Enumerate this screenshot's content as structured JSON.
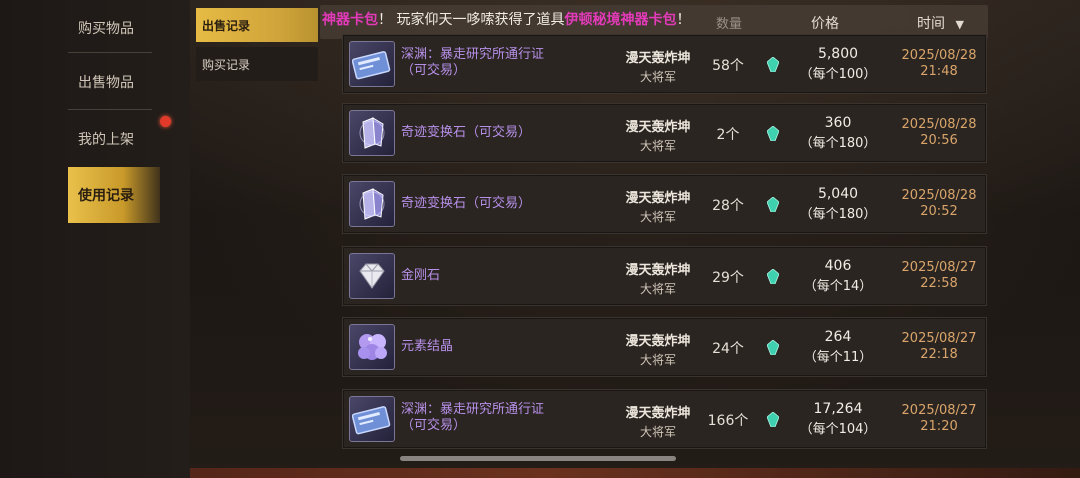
{
  "nav": {
    "items": [
      {
        "label": "购买物品"
      },
      {
        "label": "出售物品"
      },
      {
        "label": "我的上架"
      },
      {
        "label": "使用记录"
      }
    ]
  },
  "subnav": {
    "items": [
      {
        "label": "出售记录"
      },
      {
        "label": "购买记录"
      }
    ]
  },
  "header": {
    "qty_label": "数量",
    "price_label": "价格",
    "time_label": "时间"
  },
  "marquee": {
    "prefix_pink": "神器卡包",
    "text": "！  玩家仰天一哆嗦获得了道具",
    "item_pink": "伊顿秘境神器卡包",
    "suffix": "！"
  },
  "records": [
    {
      "icon": "pass-card-icon",
      "name": "深渊：暴走研究所通行证（可交易）",
      "seller": "漫天轰炸坤",
      "title": "大将军",
      "qty": "58个",
      "total": "5,800",
      "unit": "（每个100）",
      "date": "2025/08/28",
      "time": "21:48"
    },
    {
      "icon": "miracle-stone-icon",
      "name": "奇迹变换石（可交易）",
      "seller": "漫天轰炸坤",
      "title": "大将军",
      "qty": "2个",
      "total": "360",
      "unit": "（每个180）",
      "date": "2025/08/28",
      "time": "20:56"
    },
    {
      "icon": "miracle-stone-icon",
      "name": "奇迹变换石（可交易）",
      "seller": "漫天轰炸坤",
      "title": "大将军",
      "qty": "28个",
      "total": "5,040",
      "unit": "（每个180）",
      "date": "2025/08/28",
      "time": "20:52"
    },
    {
      "icon": "diamond-icon",
      "name": "金刚石",
      "seller": "漫天轰炸坤",
      "title": "大将军",
      "qty": "29个",
      "total": "406",
      "unit": "（每个14）",
      "date": "2025/08/27",
      "time": "22:58"
    },
    {
      "icon": "crystal-icon",
      "name": "元素结晶",
      "seller": "漫天轰炸坤",
      "title": "大将军",
      "qty": "24个",
      "total": "264",
      "unit": "（每个11）",
      "date": "2025/08/27",
      "time": "22:18"
    },
    {
      "icon": "pass-card-icon",
      "name": "深渊：暴走研究所通行证（可交易）",
      "seller": "漫天轰炸坤",
      "title": "大将军",
      "qty": "166个",
      "total": "17,264",
      "unit": "（每个104）",
      "date": "2025/08/27",
      "time": "21:20"
    }
  ],
  "colors": {
    "accent_gold": "#e6bb44",
    "item_purple": "#b690e8",
    "time_orange": "#d9a56a",
    "marquee_pink": "#e23ab8",
    "gem_teal": "#3fd0b0"
  }
}
